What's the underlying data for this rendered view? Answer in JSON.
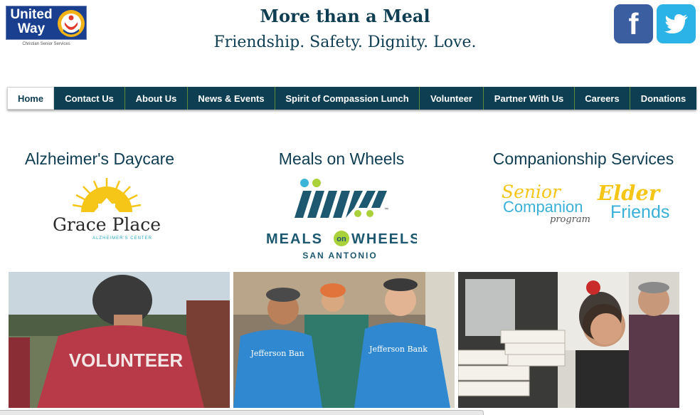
{
  "logo": {
    "line1": "United",
    "line2": "Way",
    "tagline": "Christian Senior Services"
  },
  "header": {
    "title": "More than a Meal",
    "tagline": "Friendship. Safety. Dignity. Love."
  },
  "social": {
    "facebook_glyph": "f",
    "twitter_icon": "twitter-bird-icon"
  },
  "nav": {
    "items": [
      {
        "label": "Home",
        "active": true
      },
      {
        "label": "Contact Us"
      },
      {
        "label": "About Us"
      },
      {
        "label": "News & Events"
      },
      {
        "label": "Spirit of Compassion Lunch"
      },
      {
        "label": "Volunteer"
      },
      {
        "label": "Partner With Us"
      },
      {
        "label": "Careers"
      },
      {
        "label": "Donations"
      }
    ]
  },
  "services": [
    {
      "title": "Alzheimer's Daycare",
      "logo_name": "Grace Place",
      "logo_sub": "ALZHEIMER'S CENTER"
    },
    {
      "title": "Meals on Wheels",
      "logo_line1_a": "MEALS",
      "logo_on": "on",
      "logo_line1_b": "WHEELS",
      "logo_line2": "SAN ANTONIO",
      "tm": "™"
    },
    {
      "title": "Companionship Services",
      "sc_line1": "Senior",
      "sc_line2": "Companion",
      "sc_line3": "program",
      "ef_line1": "Elder",
      "ef_line2": "Friends"
    }
  ],
  "photos": {
    "volunteer_shirt": "VOLUNTEER",
    "shirt_brand": "Jefferson Bank",
    "shirt_brand2": "Jefferson Ban"
  },
  "colors": {
    "navy": "#0e3e52",
    "brand_blue": "#1b3f8f",
    "facebook": "#3b5ea0",
    "twitter": "#2bb3e8",
    "mow_teal": "#1d5870",
    "mow_green": "#a8d13a",
    "sun_yellow": "#f5c518",
    "companion_cyan": "#3ab0d8"
  }
}
